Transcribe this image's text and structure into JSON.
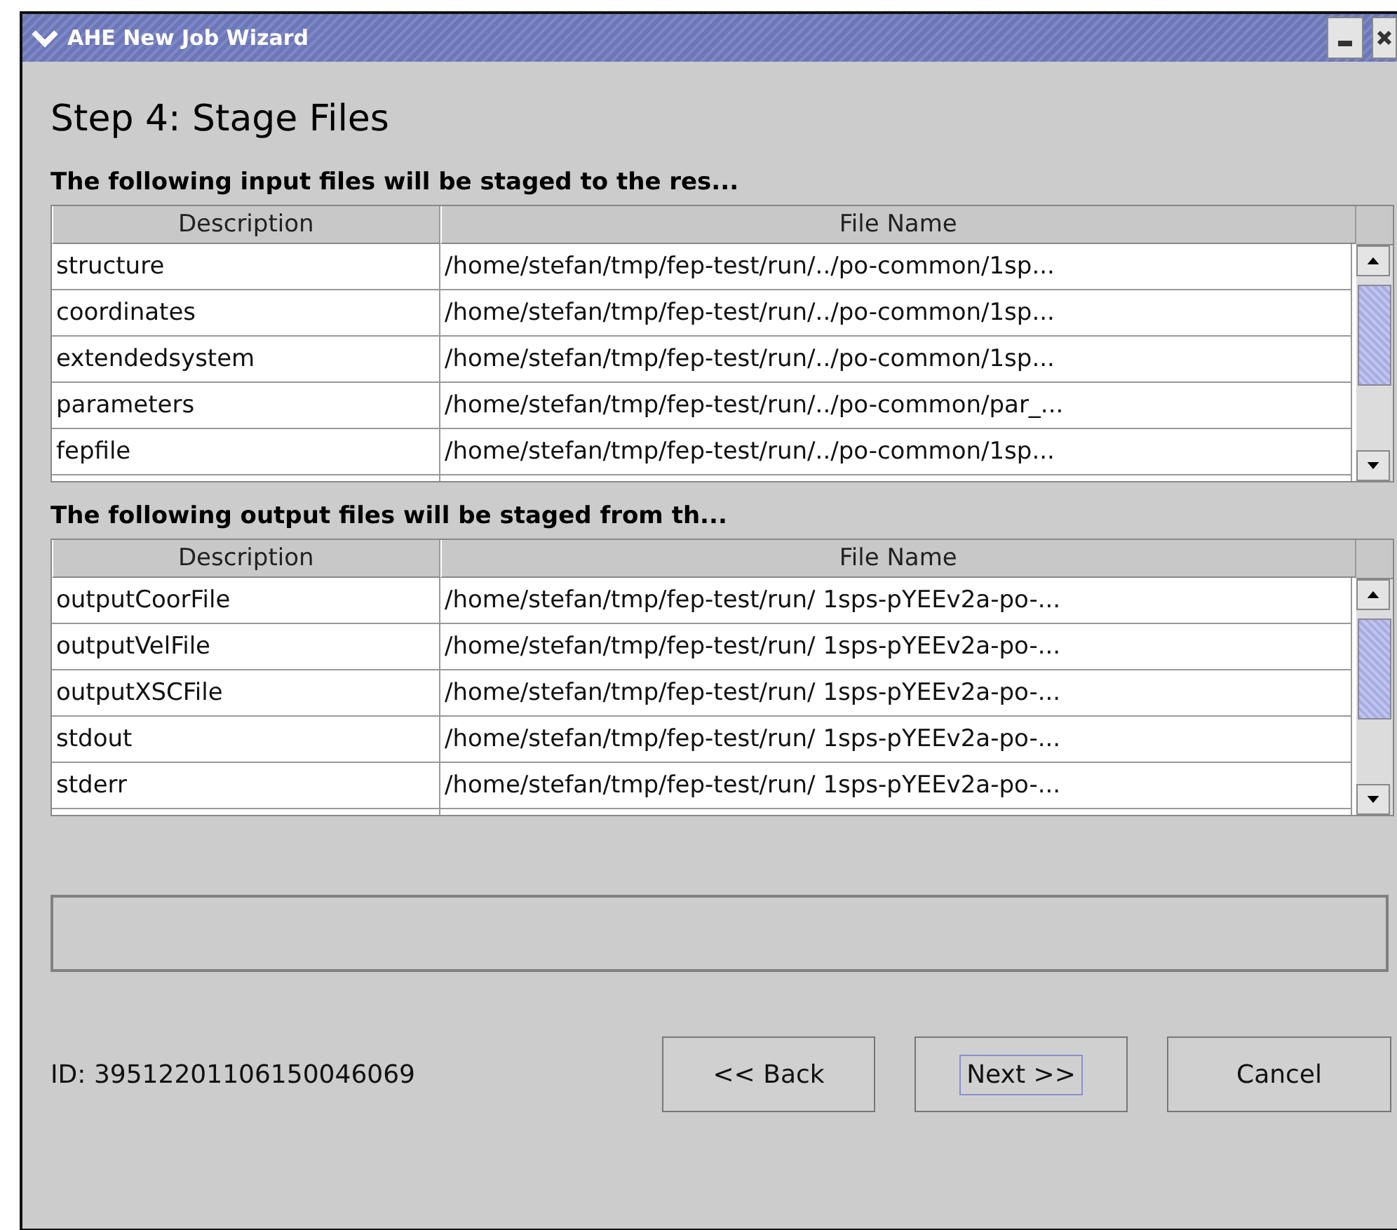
{
  "window": {
    "title": "AHE New Job Wizard"
  },
  "heading": "Step 4: Stage Files",
  "tables": [
    {
      "label": "The following input files will be staged to the res...",
      "columns": [
        "Description",
        "File Name"
      ],
      "rows": [
        [
          "structure",
          "/home/stefan/tmp/fep-test/run/../po-common/1sp..."
        ],
        [
          "coordinates",
          "/home/stefan/tmp/fep-test/run/../po-common/1sp..."
        ],
        [
          "extendedsystem",
          "/home/stefan/tmp/fep-test/run/../po-common/1sp..."
        ],
        [
          "parameters",
          "/home/stefan/tmp/fep-test/run/../po-common/par_..."
        ],
        [
          "fepfile",
          "/home/stefan/tmp/fep-test/run/../po-common/1sp..."
        ]
      ]
    },
    {
      "label": "The following output files will be staged from th...",
      "columns": [
        "Description",
        "File Name"
      ],
      "rows": [
        [
          "outputCoorFile",
          "/home/stefan/tmp/fep-test/run/ 1sps-pYEEv2a-po-..."
        ],
        [
          "outputVelFile",
          "/home/stefan/tmp/fep-test/run/ 1sps-pYEEv2a-po-..."
        ],
        [
          "outputXSCFile",
          "/home/stefan/tmp/fep-test/run/ 1sps-pYEEv2a-po-..."
        ],
        [
          "stdout",
          "/home/stefan/tmp/fep-test/run/ 1sps-pYEEv2a-po-..."
        ],
        [
          "stderr",
          "/home/stefan/tmp/fep-test/run/ 1sps-pYEEv2a-po-..."
        ]
      ]
    }
  ],
  "id_label": "ID: 39512201106150046069",
  "buttons": [
    {
      "label": "<< Back",
      "focused": false
    },
    {
      "label": "Next >>",
      "focused": true
    },
    {
      "label": "Cancel",
      "focused": false
    }
  ]
}
